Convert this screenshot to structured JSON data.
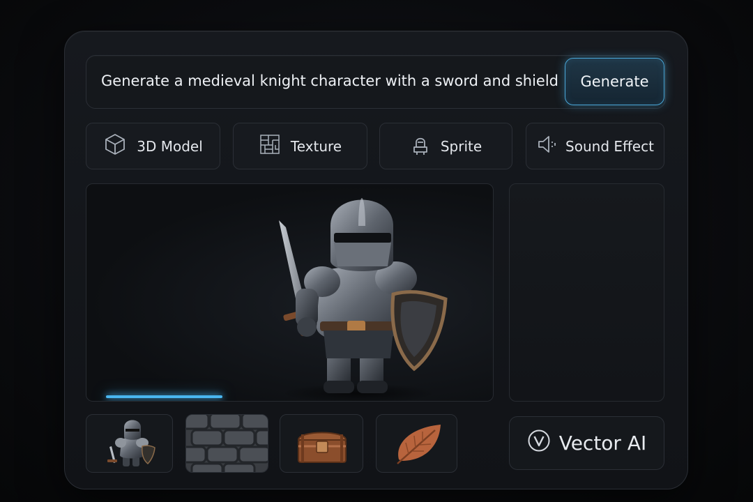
{
  "prompt": {
    "text": "Generate a medieval knight character with a sword and shield",
    "generate_label": "Generate"
  },
  "asset_types": [
    {
      "label": "3D Model",
      "icon": "cube-icon"
    },
    {
      "label": "Texture",
      "icon": "texture-grid-icon"
    },
    {
      "label": "Sprite",
      "icon": "sprite-figure-icon"
    },
    {
      "label": "Sound Effect",
      "icon": "speaker-icon"
    }
  ],
  "preview": {
    "subject": "knight-character",
    "progress_fraction": 0.3
  },
  "thumbnails": [
    {
      "name": "knight"
    },
    {
      "name": "stone-texture"
    },
    {
      "name": "treasure-chest"
    },
    {
      "name": "leaf"
    }
  ],
  "brand": {
    "name": "Vector AI",
    "logo_letter": "V"
  },
  "colors": {
    "accent": "#49b6f0",
    "panel": "#15181c",
    "border": "#2b2f36"
  }
}
